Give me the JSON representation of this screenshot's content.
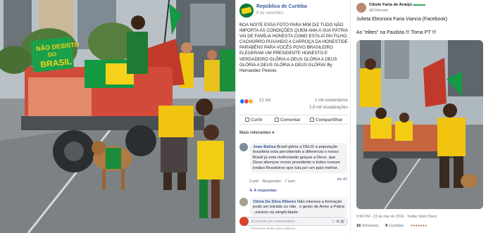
{
  "photo_left": {
    "sign_line1": "NÃO DESISTO",
    "sign_line2": "DO",
    "sign_line3": "BRASIL"
  },
  "post": {
    "page_name": "República de Curitiba",
    "date": "8 de setembro",
    "text": "BOA NOITE ESSA FOTO PARA MIM DIZ TUDO NÃO IMPORTA AS CONDIÇÕES QUEM AMA A SUA PÁTRIA VAI DE FAMÍLIA HONESTA COMO ESTA AÍ PAI FILHO, CACHORRO PUXANDO A CARROÇA DA HONESTIDE PARABÉNS PARA VOCÊS POVO BRASILEIRO ELEGERAM UM PRESIDENTE HONESTO E VERDADEIRO GLÓRIA A DEUS GLÓRIA A DEUS GLÓRIA A DEUS GLÓRIA A DEUS GLÓRIA! By Hernandez Peixoto",
    "reactions": "12 mil",
    "comments_count": "1 mil comentários",
    "views_count": "2,8 mil visualizações",
    "actions": {
      "like": "Curtir",
      "comment": "Comentar",
      "share": "Compartilhar"
    },
    "sort_label": "Mais relevantes",
    "comments": [
      {
        "author": "Joao Batisa",
        "text": "Brasil glória a DEUS a população brasileira esta percebendo a diferencia o nosso Brasil ja esta melhorando graças a Deus. que Deus abençoe nosso presidente e todos nossos irmãos Brasileiros que luta por um país melhor.",
        "meta": "Curtir · Responder · 7 sem",
        "reactions": "43",
        "replies": "4 respostas"
      },
      {
        "author": "Olivia Da Silva Ribeiro",
        "text": "Não interesa a formação pode ser letrado ou não . o gesto de Amor a Pátria , mesmo na simplicidade"
      }
    ],
    "compose_placeholder": "Escreva um comentário...",
    "compose_hint": "Pressione Enter para publicar."
  },
  "tweet": {
    "name": "Cibele Faria de Araújo",
    "handle": "@Cibecare",
    "text1": "Julieta Eleonora Faria Vianna (Facebook)",
    "text2": "As \"elites\" na Paulista !!! Toma PT !!!",
    "timestamp": "9:58 PM - 13 de mar de 2016 · Twitter Web Client",
    "retweets_count": "16",
    "retweets_label": "Retweets",
    "likes_count": "9",
    "likes_label": "Curtidas"
  },
  "colors": {
    "brazil_green": "#139a43",
    "brazil_yellow": "#f6d21c",
    "facebook_blue": "#385898",
    "like_blue": "#1877f2"
  }
}
